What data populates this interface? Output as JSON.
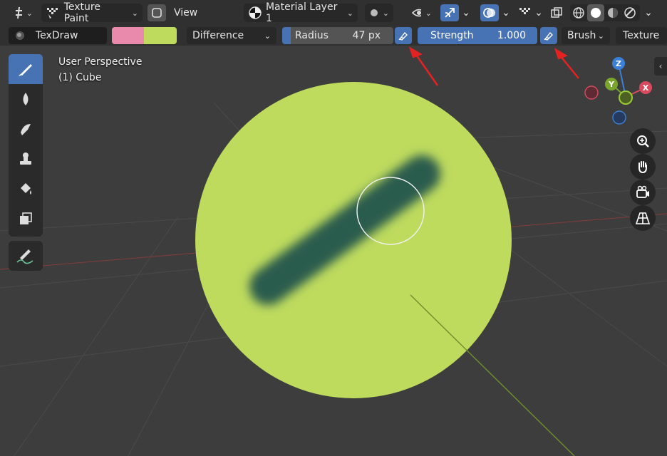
{
  "header": {
    "mode": {
      "label": "Texture Paint"
    },
    "view_menu": "View",
    "material_slot": {
      "label": "Material Layer 1"
    }
  },
  "tool_settings": {
    "brush_name": "TexDraw",
    "blend_mode": "Difference",
    "radius": {
      "label": "Radius",
      "value": "47 px"
    },
    "strength": {
      "label": "Strength",
      "value": "1.000"
    },
    "brush_menu": "Brush",
    "texture_menu": "Texture",
    "primary_color": "#e98aad",
    "secondary_color": "#bfdb5e"
  },
  "viewport": {
    "view_name": "User Perspective",
    "object_name": "(1) Cube",
    "paint_color": "#bfdb5e",
    "stroke_color": "#2c5c4e",
    "gizmo_axes": {
      "x": "X",
      "y": "Y",
      "z": "Z"
    }
  },
  "toolbar": {
    "tools": [
      "draw-brush-icon",
      "soften-icon",
      "smear-icon",
      "clone-icon",
      "fill-icon",
      "mask-icon"
    ],
    "annotate": "annotate-icon"
  }
}
